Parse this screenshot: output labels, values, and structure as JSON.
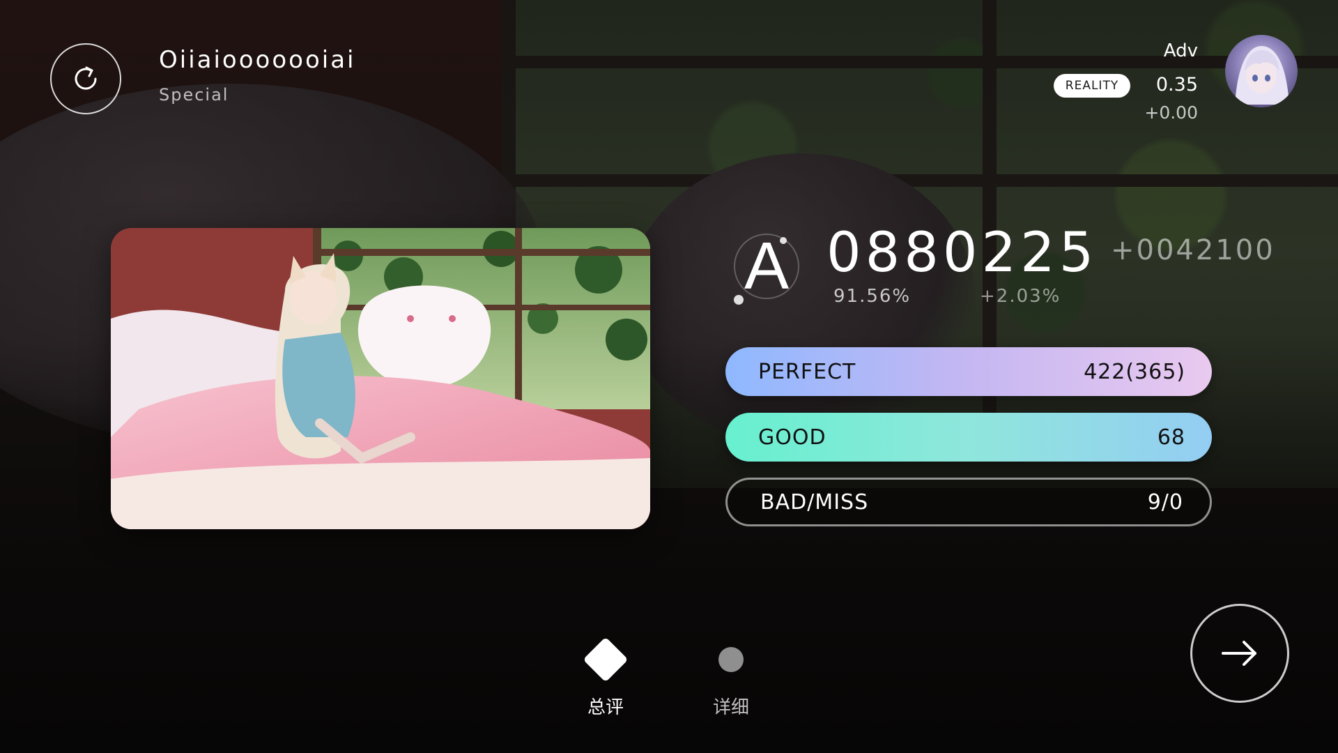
{
  "song": {
    "title": "Oiiaiooooooiai",
    "difficulty": "Special"
  },
  "player": {
    "name": "Adv",
    "badge": "REALITY",
    "rks": "0.35",
    "rks_delta": "+0.00"
  },
  "result": {
    "grade": "A",
    "score": "0880225",
    "score_delta": "+0042100",
    "accuracy": "91.56%",
    "accuracy_delta": "+2.03%"
  },
  "judgements": {
    "perfect": {
      "label": "PERFECT",
      "value": "422(365)"
    },
    "good": {
      "label": "GOOD",
      "value": "68"
    },
    "bad_miss": {
      "label": "BAD/MISS",
      "value": "9/0"
    }
  },
  "tabs": {
    "overview": "总评",
    "detail": "详细"
  },
  "colors": {
    "perfect_gradient": [
      "#8fb8ff",
      "#e9c9ef"
    ],
    "good_gradient": [
      "#67f0cf",
      "#94cdf3"
    ]
  },
  "icons": [
    "retry-icon",
    "next-arrow-icon",
    "diamond-tab-icon",
    "dot-tab-icon"
  ]
}
